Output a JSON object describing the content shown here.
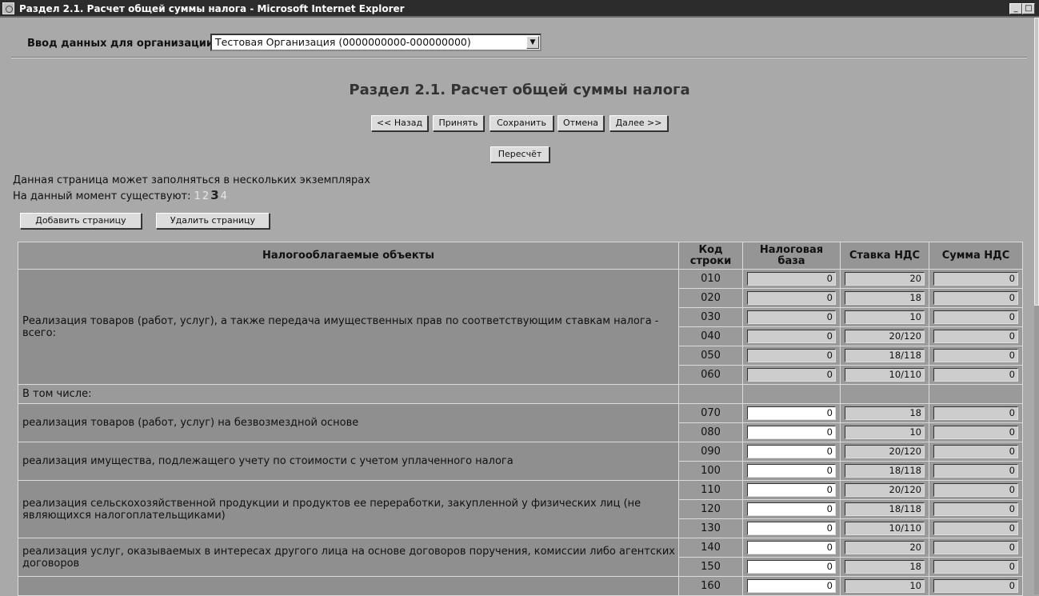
{
  "window": {
    "title": "Раздел 2.1. Расчет общей суммы налога - Microsoft Internet Explorer",
    "min_glyph": "_",
    "max_glyph": "□"
  },
  "org": {
    "label": "Ввод данных для организации",
    "selected": "Тестовая Организация (0000000000-000000000)"
  },
  "page_title": "Раздел 2.1. Расчет общей суммы налога",
  "toolbar": {
    "back_label": "<< Назад",
    "accept_label": "Принять",
    "save_label": "Сохранить",
    "cancel_label": "Отмена",
    "next_label": "Далее >>",
    "recalc_label": "Пересчёт"
  },
  "instances": {
    "note": "Данная страница может заполняться в нескольких экземплярах",
    "existing_label": "На данный момент существуют:",
    "pages": [
      "1",
      "2",
      "3",
      "4"
    ],
    "current_page": "3",
    "add_label": "Добавить страницу",
    "delete_label": "Удалить страницу"
  },
  "table": {
    "headers": {
      "object": "Налогооблагаемые объекты",
      "code_l1": "Код",
      "code_l2": "строки",
      "base_l1": "Налоговая",
      "base_l2": "база",
      "rate": "Ставка НДС",
      "sum": "Сумма НДС"
    },
    "groups": [
      {
        "object": "Реализация товаров (работ, услуг), а также передача имущественных прав по соответствующим ставкам налога - всего:",
        "rows": [
          {
            "code": "010",
            "base": "0",
            "rate": "20",
            "sum": "0",
            "base_editable": false
          },
          {
            "code": "020",
            "base": "0",
            "rate": "18",
            "sum": "0",
            "base_editable": false
          },
          {
            "code": "030",
            "base": "0",
            "rate": "10",
            "sum": "0",
            "base_editable": false
          },
          {
            "code": "040",
            "base": "0",
            "rate": "20/120",
            "sum": "0",
            "base_editable": false
          },
          {
            "code": "050",
            "base": "0",
            "rate": "18/118",
            "sum": "0",
            "base_editable": false
          },
          {
            "code": "060",
            "base": "0",
            "rate": "10/110",
            "sum": "0",
            "base_editable": false
          }
        ]
      },
      {
        "section": "В том числе:"
      },
      {
        "object": "реализация товаров (работ, услуг) на безвозмездной основе",
        "rows": [
          {
            "code": "070",
            "base": "0",
            "rate": "18",
            "sum": "0",
            "base_editable": true
          },
          {
            "code": "080",
            "base": "0",
            "rate": "10",
            "sum": "0",
            "base_editable": true
          }
        ]
      },
      {
        "object": "реализация имущества, подлежащего учету по стоимости с учетом уплаченного налога",
        "rows": [
          {
            "code": "090",
            "base": "0",
            "rate": "20/120",
            "sum": "0",
            "base_editable": true
          },
          {
            "code": "100",
            "base": "0",
            "rate": "18/118",
            "sum": "0",
            "base_editable": true
          }
        ]
      },
      {
        "object": "реализация сельскохозяйственной продукции и продуктов ее переработки, закупленной у физических лиц (не являющихся налогоплательщиками)",
        "rows": [
          {
            "code": "110",
            "base": "0",
            "rate": "20/120",
            "sum": "0",
            "base_editable": true
          },
          {
            "code": "120",
            "base": "0",
            "rate": "18/118",
            "sum": "0",
            "base_editable": true
          },
          {
            "code": "130",
            "base": "0",
            "rate": "10/110",
            "sum": "0",
            "base_editable": true
          }
        ]
      },
      {
        "object": "реализация услуг, оказываемых в интересах другого лица на основе договоров поручения, комиссии либо агентских договоров",
        "rows": [
          {
            "code": "140",
            "base": "0",
            "rate": "20",
            "sum": "0",
            "base_editable": true
          },
          {
            "code": "150",
            "base": "0",
            "rate": "18",
            "sum": "0",
            "base_editable": true
          }
        ]
      },
      {
        "object": "",
        "rows": [
          {
            "code": "160",
            "base": "0",
            "rate": "10",
            "sum": "0",
            "base_editable": true
          }
        ]
      }
    ]
  }
}
